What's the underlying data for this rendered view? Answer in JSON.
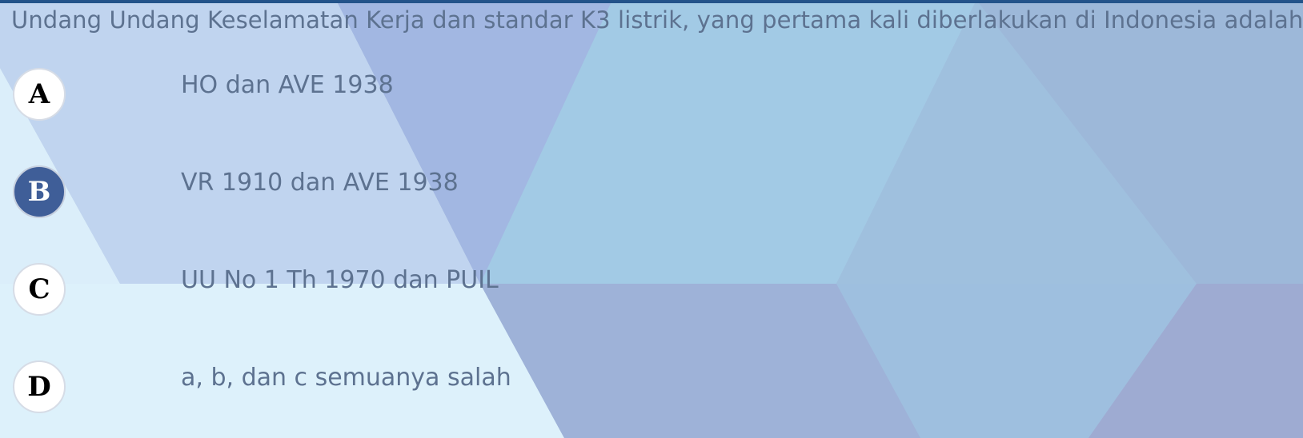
{
  "quiz": {
    "question": "Undang Undang Keselamatan Kerja dan standar K3 listrik, yang pertama kali diberlakukan di Indonesia adalah:",
    "options": [
      {
        "letter": "A",
        "text": "HO dan AVE 1938",
        "selected": false
      },
      {
        "letter": "B",
        "text": "VR 1910 dan AVE 1938",
        "selected": true
      },
      {
        "letter": "C",
        "text": "UU No 1 Th 1970 dan PUIL",
        "selected": false
      },
      {
        "letter": "D",
        "text": "a, b, dan c semuanya salah",
        "selected": false
      }
    ]
  },
  "colors": {
    "selected_badge": "#3f5e98",
    "text": "#5d7290",
    "top_bar": "#23538a"
  }
}
